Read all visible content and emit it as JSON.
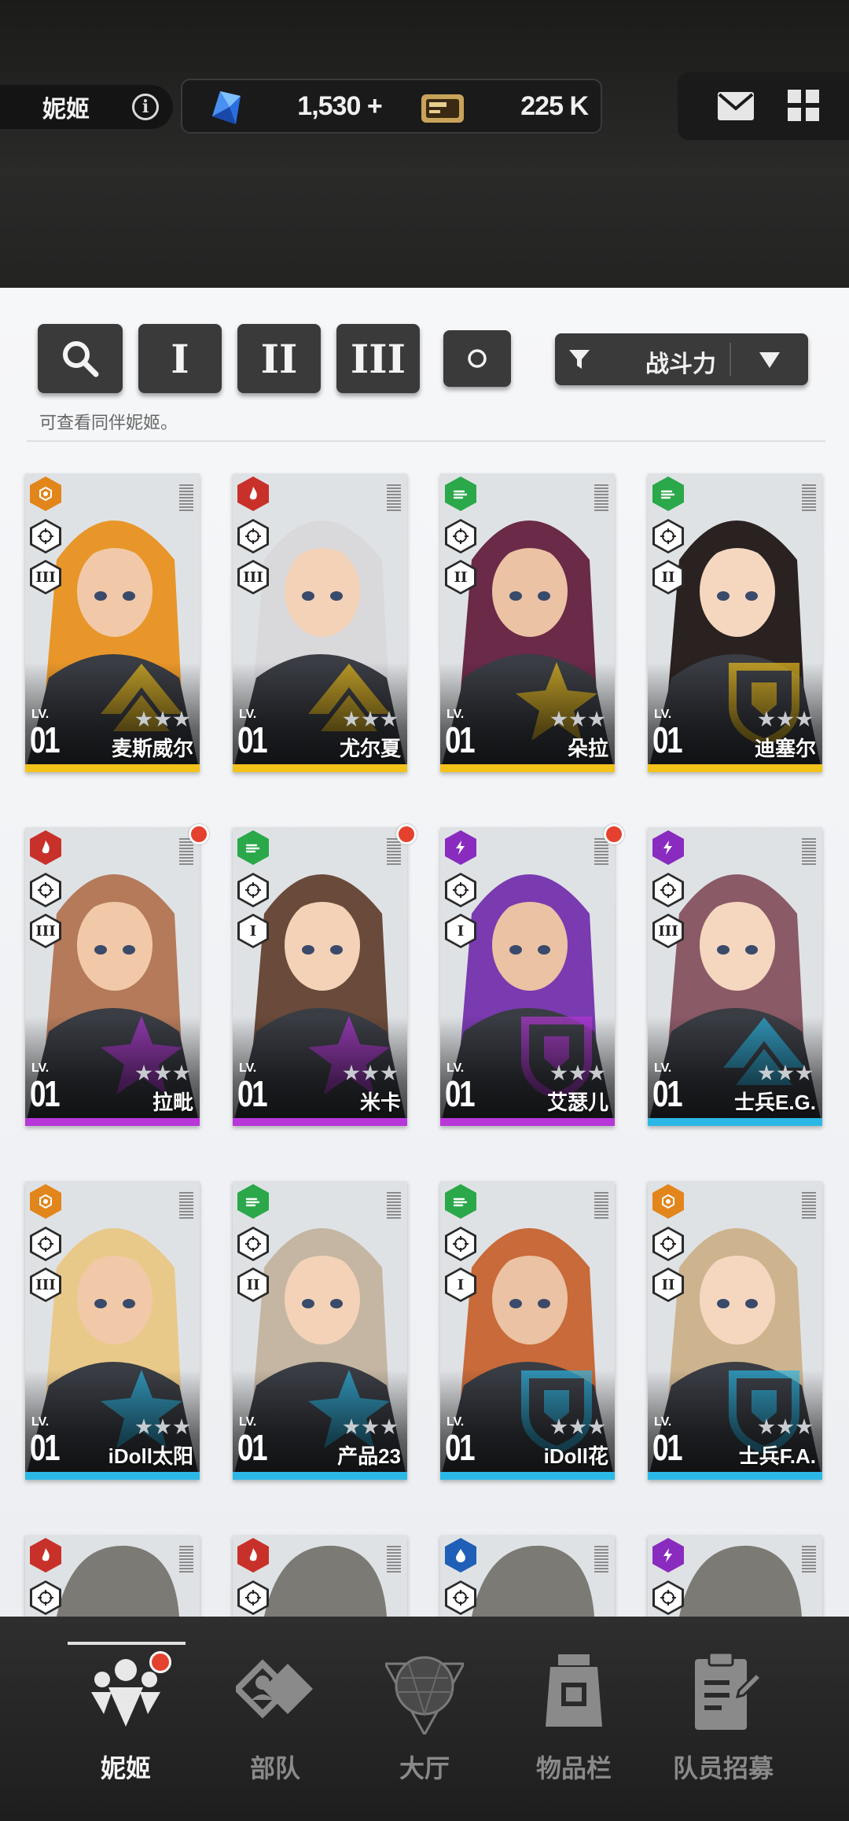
{
  "header": {
    "title": "妮姬",
    "info_icon": "info-icon",
    "gems": "1,530",
    "gems_plus": "+",
    "credits": "225 K",
    "icons": [
      "gem-icon",
      "credit-card-icon",
      "mail-icon",
      "grid-menu-icon"
    ]
  },
  "filters": {
    "search_icon": "search-icon",
    "burst_1": "I",
    "burst_2": "II",
    "burst_3": "III",
    "all_burst_icon": "circle-icon",
    "sort_label": "战斗力",
    "hint": "可查看同伴妮姬。"
  },
  "colors": {
    "fire": "#c8312a",
    "wind": "#2aa84a",
    "electric": "#8a2bbf",
    "iron": "#e2861c",
    "water": "#1f5fb8",
    "rarity_ssr": "#f2c21a",
    "rarity_sr": "#b737d9",
    "rarity_r": "#2cb8e6"
  },
  "cards": [
    {
      "name": "麦斯威尔",
      "lv_label": "LV.",
      "level": "01",
      "element": "iron",
      "burst": "III",
      "rarity": "ssr",
      "mfg": "elysion",
      "new": false
    },
    {
      "name": "尤尔夏",
      "lv_label": "LV.",
      "level": "01",
      "element": "fire",
      "burst": "III",
      "rarity": "ssr",
      "mfg": "elysion",
      "new": false
    },
    {
      "name": "朵拉",
      "lv_label": "LV.",
      "level": "01",
      "element": "wind",
      "burst": "II",
      "rarity": "ssr",
      "mfg": "missilis",
      "new": false
    },
    {
      "name": "迪塞尔",
      "lv_label": "LV.",
      "level": "01",
      "element": "wind",
      "burst": "II",
      "rarity": "ssr",
      "mfg": "tetra",
      "new": false
    },
    {
      "name": "拉毗",
      "lv_label": "LV.",
      "level": "01",
      "element": "fire",
      "burst": "III",
      "rarity": "sr",
      "mfg": "missilis",
      "new": true
    },
    {
      "name": "米卡",
      "lv_label": "LV.",
      "level": "01",
      "element": "wind",
      "burst": "I",
      "rarity": "sr",
      "mfg": "missilis",
      "new": true
    },
    {
      "name": "艾瑟儿",
      "lv_label": "LV.",
      "level": "01",
      "element": "electric",
      "burst": "I",
      "rarity": "sr",
      "mfg": "tetra",
      "new": true
    },
    {
      "name": "士兵E.G.",
      "lv_label": "LV.",
      "level": "01",
      "element": "electric",
      "burst": "III",
      "rarity": "r",
      "mfg": "elysion",
      "new": false
    },
    {
      "name": "iDoll太阳",
      "lv_label": "LV.",
      "level": "01",
      "element": "iron",
      "burst": "III",
      "rarity": "r",
      "mfg": "missilis",
      "new": false
    },
    {
      "name": "产品23",
      "lv_label": "LV.",
      "level": "01",
      "element": "wind",
      "burst": "II",
      "rarity": "r",
      "mfg": "missilis",
      "new": false
    },
    {
      "name": "iDoll花",
      "lv_label": "LV.",
      "level": "01",
      "element": "wind",
      "burst": "I",
      "rarity": "r",
      "mfg": "tetra",
      "new": false
    },
    {
      "name": "士兵F.A.",
      "lv_label": "LV.",
      "level": "01",
      "element": "iron",
      "burst": "II",
      "rarity": "r",
      "mfg": "tetra",
      "new": false
    }
  ],
  "partial_cards": [
    {
      "element": "fire"
    },
    {
      "element": "fire"
    },
    {
      "element": "water"
    },
    {
      "element": "electric"
    }
  ],
  "nav": [
    {
      "label": "妮姬",
      "icon": "nikke-icon",
      "active": true,
      "badge": true
    },
    {
      "label": "部队",
      "icon": "squad-icon",
      "active": false,
      "badge": false
    },
    {
      "label": "大厅",
      "icon": "lobby-icon",
      "active": false,
      "badge": false
    },
    {
      "label": "物品栏",
      "icon": "inventory-icon",
      "active": false,
      "badge": false
    },
    {
      "label": "队员招募",
      "icon": "recruit-icon",
      "active": false,
      "badge": false
    }
  ]
}
